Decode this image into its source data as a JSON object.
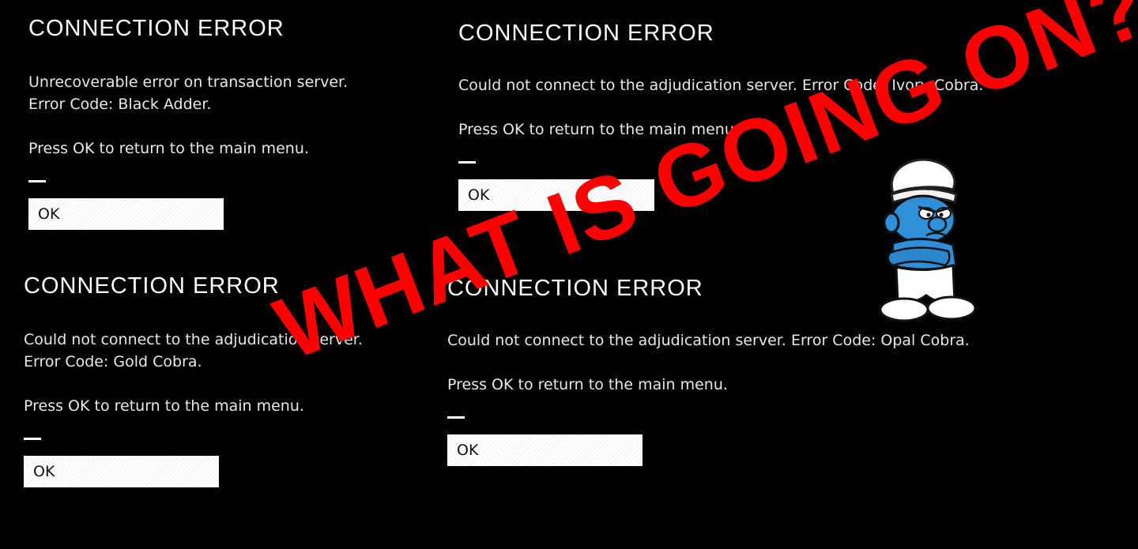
{
  "dialogs": [
    {
      "title": "CONNECTION ERROR",
      "message": "Unrecoverable error on transaction server.\nError Code: Black Adder.",
      "prompt": "Press OK to return to the main menu.",
      "ok_label": "OK"
    },
    {
      "title": "CONNECTION ERROR",
      "message": "Could not connect to the adjudication server. Error Code: Ivory Cobra.",
      "prompt": "Press OK to return to the main menu.",
      "ok_label": "OK"
    },
    {
      "title": "CONNECTION ERROR",
      "message": "Could not connect to the adjudication server.\nError Code: Gold Cobra.",
      "prompt": "Press OK to return to the main menu.",
      "ok_label": "OK"
    },
    {
      "title": "CONNECTION ERROR",
      "message": "Could not connect to the adjudication server. Error Code: Opal Cobra.",
      "prompt": "Press OK to return to the main menu.",
      "ok_label": "OK"
    }
  ],
  "overlay": {
    "text": "WHAT IS GOING ON?",
    "color": "#ff0000"
  },
  "mascot": {
    "icon": "grumpy-smurf-icon",
    "body_color": "#2f8fd8",
    "hat_color": "#ffffff"
  }
}
